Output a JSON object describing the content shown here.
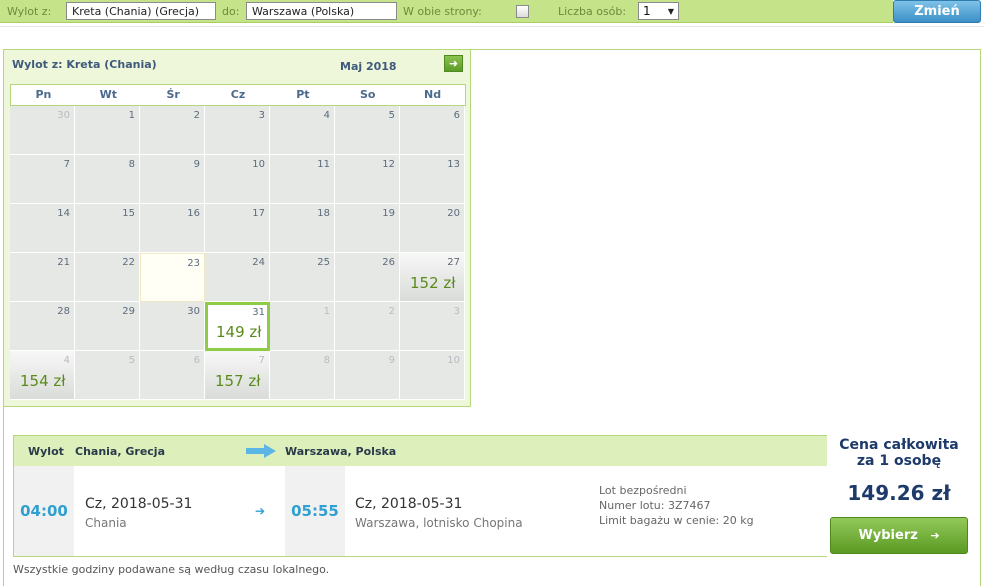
{
  "search": {
    "from_label": "Wylot z:",
    "from_value": "Kreta (Chania) (Grecja)",
    "to_label": "do:",
    "to_value": "Warszawa (Polska)",
    "roundtrip_label": "W obie strony:",
    "roundtrip_checked": false,
    "people_label": "Liczba osób:",
    "people_value": "1",
    "change_button": "Zmień"
  },
  "calendar": {
    "title": "Wylot z: Kreta (Chania)",
    "month": "Maj 2018",
    "weekdays": [
      "Pn",
      "Wt",
      "Śr",
      "Cz",
      "Pt",
      "So",
      "Nd"
    ],
    "weeks": [
      [
        {
          "day": "30",
          "other": true
        },
        {
          "day": "1"
        },
        {
          "day": "2"
        },
        {
          "day": "3"
        },
        {
          "day": "4"
        },
        {
          "day": "5"
        },
        {
          "day": "6"
        }
      ],
      [
        {
          "day": "7"
        },
        {
          "day": "8"
        },
        {
          "day": "9"
        },
        {
          "day": "10"
        },
        {
          "day": "11"
        },
        {
          "day": "12"
        },
        {
          "day": "13"
        }
      ],
      [
        {
          "day": "14"
        },
        {
          "day": "15"
        },
        {
          "day": "16"
        },
        {
          "day": "17"
        },
        {
          "day": "18"
        },
        {
          "day": "19"
        },
        {
          "day": "20"
        }
      ],
      [
        {
          "day": "21"
        },
        {
          "day": "22"
        },
        {
          "day": "23",
          "today": true
        },
        {
          "day": "24"
        },
        {
          "day": "25"
        },
        {
          "day": "26"
        },
        {
          "day": "27",
          "price": "152 zł"
        }
      ],
      [
        {
          "day": "28"
        },
        {
          "day": "29"
        },
        {
          "day": "30"
        },
        {
          "day": "31",
          "price": "149 zł",
          "selected": true
        },
        {
          "day": "1",
          "other": true
        },
        {
          "day": "2",
          "other": true
        },
        {
          "day": "3",
          "other": true
        }
      ],
      [
        {
          "day": "4",
          "other": true,
          "price": "154 zł"
        },
        {
          "day": "5",
          "other": true
        },
        {
          "day": "6",
          "other": true
        },
        {
          "day": "7",
          "other": true,
          "price": "157 zł"
        },
        {
          "day": "8",
          "other": true
        },
        {
          "day": "9",
          "other": true
        },
        {
          "day": "10",
          "other": true
        }
      ]
    ]
  },
  "flight": {
    "header_label": "Wylot",
    "origin": "Chania, Grecja",
    "destination": "Warszawa, Polska",
    "depart_time": "04:00",
    "depart_date": "Cz, 2018-05-31",
    "depart_place": "Chania",
    "arrive_time": "05:55",
    "arrive_date": "Cz, 2018-05-31",
    "arrive_place": "Warszawa, lotnisko Chopina",
    "info": [
      "Lot bezpośredni",
      "Numer lotu: 3Z7467",
      "Limit bagażu w cenie: 20 kg"
    ]
  },
  "price": {
    "title_line1": "Cena całkowita",
    "title_line2": "za 1 osobę",
    "amount": "149.26 zł",
    "select_button": "Wybierz"
  },
  "footer_note": "Wszystkie godziny podawane są według czasu lokalnego.",
  "colors": {
    "accent_green": "#8ecb46",
    "price_green": "#5a8a1c",
    "time_blue": "#2fa0d0",
    "title_navy": "#1d3a6a"
  }
}
